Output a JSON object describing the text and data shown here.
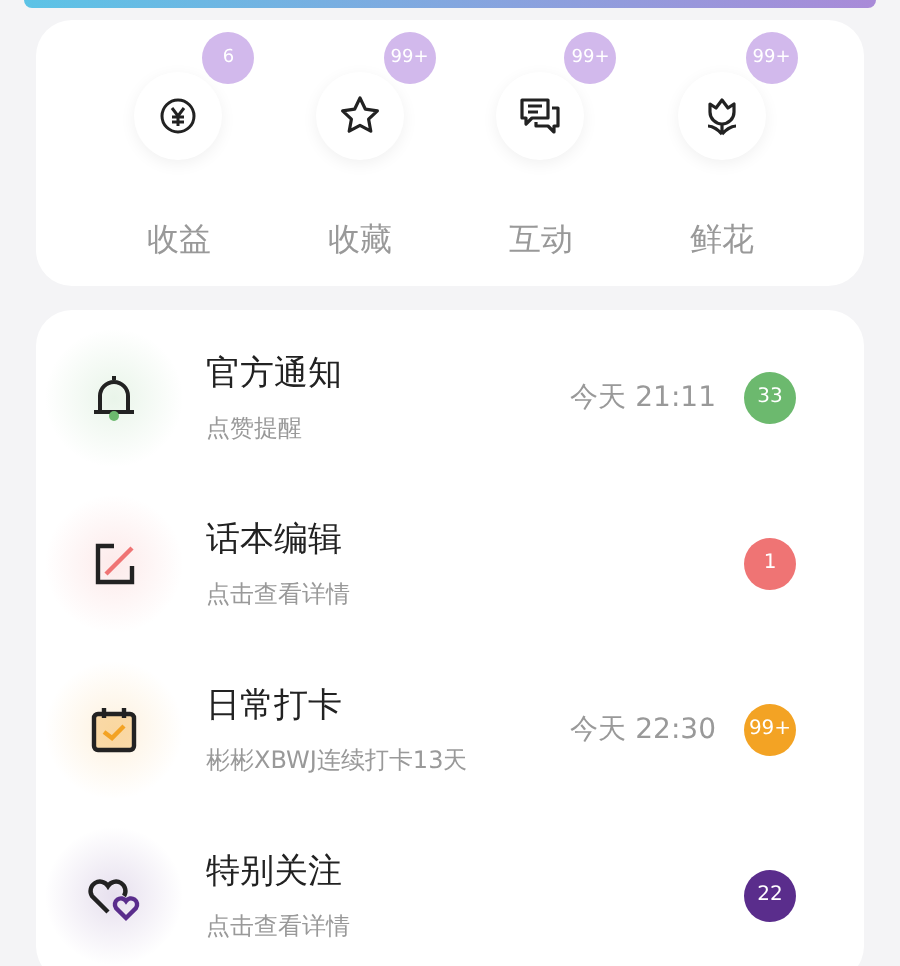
{
  "stats": [
    {
      "kind": "yen",
      "label": "收益",
      "badge": "6"
    },
    {
      "kind": "star",
      "label": "收藏",
      "badge": "99+"
    },
    {
      "kind": "chat",
      "label": "互动",
      "badge": "99+"
    },
    {
      "kind": "flower",
      "label": "鲜花",
      "badge": "99+"
    }
  ],
  "messages": [
    {
      "kind": "bell",
      "title": "官方通知",
      "subtitle": "点赞提醒",
      "time": "今天 21:11",
      "badge": "33",
      "color": "#6cb96e"
    },
    {
      "kind": "edit",
      "title": "话本编辑",
      "subtitle": "点击查看详情",
      "badge": "1",
      "color": "#ef7474"
    },
    {
      "kind": "calendar",
      "title": "日常打卡",
      "subtitle": "彬彬XBWJ连续打卡13天",
      "time": "今天 22:30",
      "badge": "99+",
      "color": "#f3a324"
    },
    {
      "kind": "hearts",
      "title": "特别关注",
      "subtitle": "点击查看详情",
      "badge": "22",
      "color": "#5a2d8c"
    }
  ]
}
